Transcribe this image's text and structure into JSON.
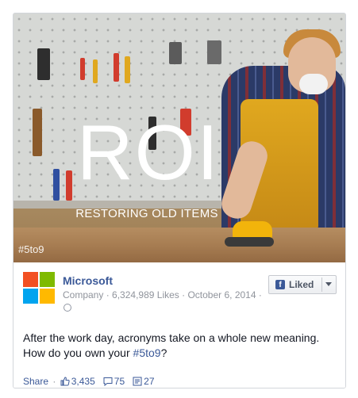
{
  "post": {
    "image": {
      "title": "ROI",
      "subtitle": "RESTORING OLD ITEMS",
      "hashtag": "#5to9"
    },
    "page": {
      "name": "Microsoft",
      "category": "Company",
      "likes": "6,324,989 Likes",
      "date": "October 6, 2014",
      "separator": "·"
    },
    "like_button": {
      "label": "Liked"
    },
    "text": {
      "line1": "After the work day, acronyms take on a whole new meaning.",
      "line2_prefix": "How do you own your ",
      "hashtag": "#5to9",
      "line2_suffix": "?"
    },
    "actions": {
      "share": "Share",
      "likes": "3,435",
      "comments": "75",
      "shares": "27"
    }
  },
  "colors": {
    "link": "#3b5998",
    "text": "#141823",
    "meta": "#90949c",
    "ms_red": "#f25022",
    "ms_green": "#7fba00",
    "ms_blue": "#00a4ef",
    "ms_yellow": "#ffb900"
  }
}
